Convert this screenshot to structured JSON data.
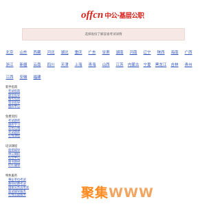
{
  "header": {
    "logo_mark": "offcn",
    "logo_text": "中公·基层公职"
  },
  "prompt": {
    "text": "选择省份了解该省考试详情"
  },
  "provinces": [
    [
      "北京",
      "山东",
      "西藏",
      "河北",
      "湖北",
      "重庆",
      "广东",
      "甘肃",
      "湖南",
      "河南",
      "辽宁",
      "陕西",
      "海南",
      "广西"
    ],
    [
      "浙江",
      "新疆",
      "云南",
      "四川",
      "天津",
      "上海",
      "青海",
      "山西",
      "江苏",
      "内蒙古",
      "宁夏",
      "黑龙江",
      "吉林",
      "贵州"
    ],
    [
      "江西",
      "安徽",
      "福建"
    ]
  ],
  "sections": [
    {
      "title": "新手指南",
      "links": [
        "考试指南",
        "题型指导",
        "报考指南",
        "资讯指导",
        "图库中心"
      ]
    },
    {
      "title": "免费资料",
      "links": [
        "考试题库",
        "题库学习",
        "公考在线",
        "考试题库",
        "在线课程"
      ]
    },
    {
      "title": "培训课程",
      "links": [
        "面授辅导",
        "中公网校",
        "综合中心",
        "图书教材",
        "OTC辅导"
      ]
    },
    {
      "title": "特色服务",
      "links": [
        "事业单位考试",
        "教师招聘考试",
        "国家公务员考试",
        "面试辅导服务",
        "在线答疑服务"
      ]
    }
  ],
  "watermark": {
    "cn": "聚集",
    "www": "WWW"
  }
}
